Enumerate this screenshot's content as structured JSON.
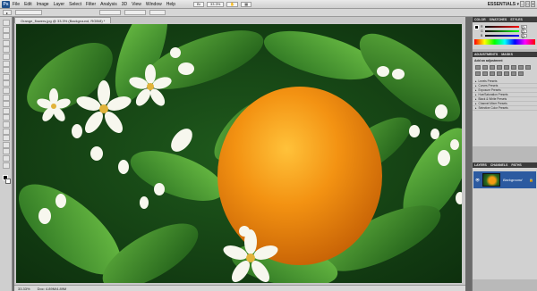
{
  "app": {
    "logo_text": "Ps",
    "menus": [
      "File",
      "Edit",
      "Image",
      "Layer",
      "Select",
      "Filter",
      "Analysis",
      "3D",
      "View",
      "Window",
      "Help"
    ],
    "zoom_chip": "33.3%",
    "workspace": "ESSENTIALS ▾",
    "window_controls": [
      "–",
      "□",
      "✕"
    ]
  },
  "options": {
    "items": [
      "",
      "",
      "",
      ""
    ]
  },
  "document": {
    "tab_title": "Orange_flowers.jpg @ 33.3% (Background, RGB/8) *",
    "status_zoom": "33.33%",
    "status_doc": "Doc: 4.89M/4.89M"
  },
  "panels": {
    "color_tabs": [
      "COLOR",
      "SWATCHES",
      "STYLES"
    ],
    "color_rows": [
      {
        "label": "R",
        "value": "0"
      },
      {
        "label": "G",
        "value": "0"
      },
      {
        "label": "B",
        "value": "0"
      }
    ],
    "adjust_tabs": [
      "ADJUSTMENTS",
      "MASKS"
    ],
    "adjust_title": "Add an adjustment",
    "presets": [
      "Levels Presets",
      "Curves Presets",
      "Exposure Presets",
      "Hue/Saturation Presets",
      "Black & White Presets",
      "Channel Mixer Presets",
      "Selective Color Presets"
    ],
    "layers_tabs": [
      "LAYERS",
      "CHANNELS",
      "PATHS"
    ],
    "layer_name": "Background"
  },
  "colors": {
    "orange": "#f39212",
    "leaf": "#2f7a25",
    "layer_select": "#2c5aa0"
  }
}
